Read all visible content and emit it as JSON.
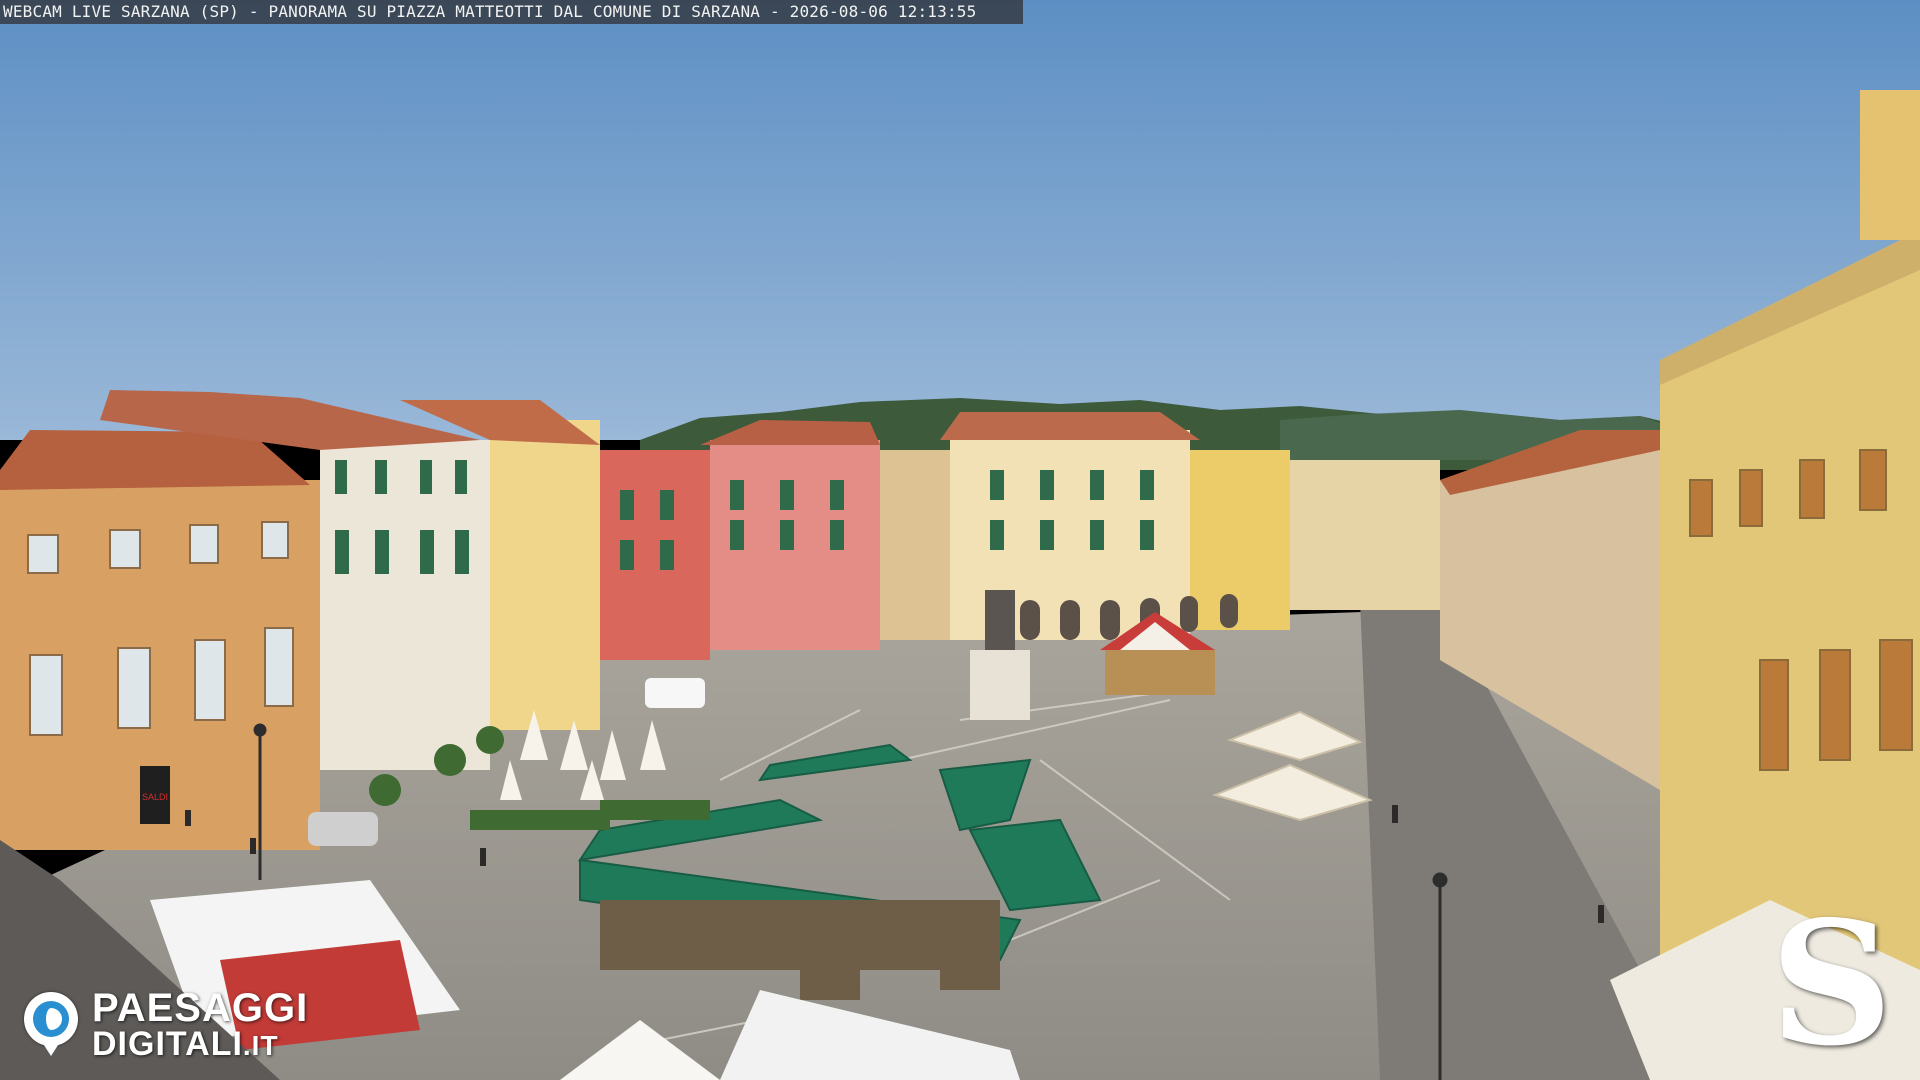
{
  "webcam": {
    "caption": "WEBCAM LIVE SARZANA (SP) - PANORAMA SU PIAZZA MATTEOTTI DAL COMUNE DI SARZANA - 2026-08-06  12:13:55"
  },
  "watermarks": {
    "left_logo_line1": "PAESAGGI",
    "left_logo_line2": "DIGITALI",
    "left_logo_tld": ".IT",
    "right_logo_letter": "S"
  },
  "scene": {
    "shop_sign": "SALDI"
  },
  "colors": {
    "sky": "#6a98c7",
    "paving": "#9c9a94",
    "awning_green": "#1f7a5a",
    "roof_terracotta": "#b5603f"
  }
}
